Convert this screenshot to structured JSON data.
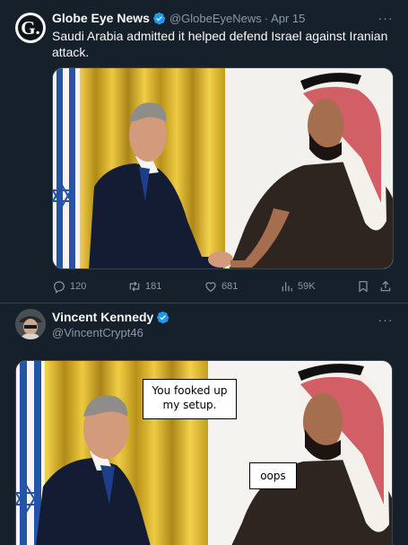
{
  "posts": [
    {
      "author": "Globe Eye News",
      "handle": "@GlobeEyeNews",
      "separator": "·",
      "date": "Apr 15",
      "avatar_letter": "G.",
      "text": "Saudi Arabia admitted it helped defend Israel against Iranian attack.",
      "actions": {
        "replies": "120",
        "reposts": "181",
        "likes": "681",
        "views": "59K"
      }
    },
    {
      "author": "Vincent Kennedy",
      "handle": "@VincentCrypt46",
      "bubbles": {
        "left": "You fooked up my setup.",
        "right": "oops"
      }
    }
  ],
  "icons": {
    "more": "more-icon",
    "verified": "verified-badge-icon",
    "reply": "reply-icon",
    "repost": "repost-icon",
    "like": "like-icon",
    "views": "views-icon",
    "bookmark": "bookmark-icon",
    "share": "share-icon"
  },
  "colors": {
    "background": "#15202b",
    "text": "#f7f9f9",
    "secondary": "#8b98a5",
    "verified": "#1d9bf0",
    "divider": "#38444d"
  }
}
